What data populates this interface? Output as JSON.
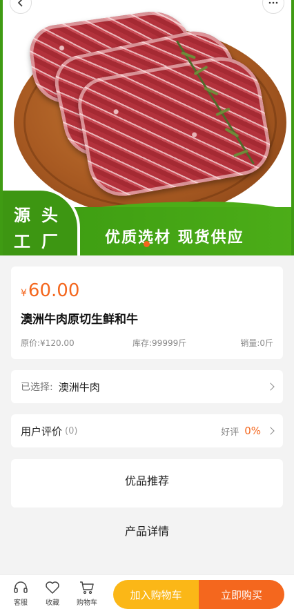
{
  "banner": {
    "badge_line1": "源头",
    "badge_line2": "工厂",
    "slogan": "优质选材 现货供应"
  },
  "product": {
    "currency_symbol": "¥",
    "price": "60.00",
    "title": "澳洲牛肉原切生鲜和牛",
    "original_price": "原价:¥120.00",
    "stock": "库存:99999斤",
    "sales": "销量:0斤"
  },
  "selection": {
    "label": "已选择:",
    "value": "澳洲牛肉"
  },
  "reviews": {
    "title": "用户评价",
    "count": "(0)",
    "good_label": "好评",
    "good_percent": "0%"
  },
  "sections": {
    "recommend": "优品推荐",
    "detail": "产品详情"
  },
  "bottom_bar": {
    "service": "客服",
    "favorite": "收藏",
    "cart": "购物车",
    "add_to_cart": "加入购物车",
    "buy_now": "立即购买"
  },
  "colors": {
    "accent": "#f4671e",
    "secondary": "#fbb717",
    "banner_green": "#3f9b13"
  },
  "icons": {
    "back": "chevron-left-icon",
    "more": "more-icon",
    "service": "headset-icon",
    "favorite": "heart-icon",
    "cart": "cart-icon"
  }
}
